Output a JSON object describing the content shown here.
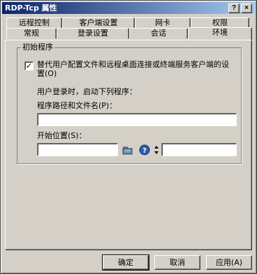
{
  "window": {
    "title": "RDP-Tcp 属性"
  },
  "titlebar_buttons": {
    "help": "?",
    "close": "×"
  },
  "tabs_row1": [
    "远程控制",
    "客户端设置",
    "网卡",
    "权限"
  ],
  "tabs_row2": [
    "常规",
    "登录设置",
    "会话",
    "环境"
  ],
  "active_tab": "环境",
  "group": {
    "title": "初始程序",
    "override_checked": true,
    "override_label_line1": "替代用户配置文件和远程桌面连接或终端服务客户端的设",
    "override_label_line2": "置(O)",
    "logon_text": "用户登录时，启动下列程序：",
    "program_label": "程序路径和文件名(P)：",
    "program_value": "",
    "startin_label": "开始位置(S)：",
    "startin_value": "",
    "extra_value": ""
  },
  "buttons": {
    "ok": "确定",
    "cancel": "取消",
    "apply": "应用(A)"
  }
}
